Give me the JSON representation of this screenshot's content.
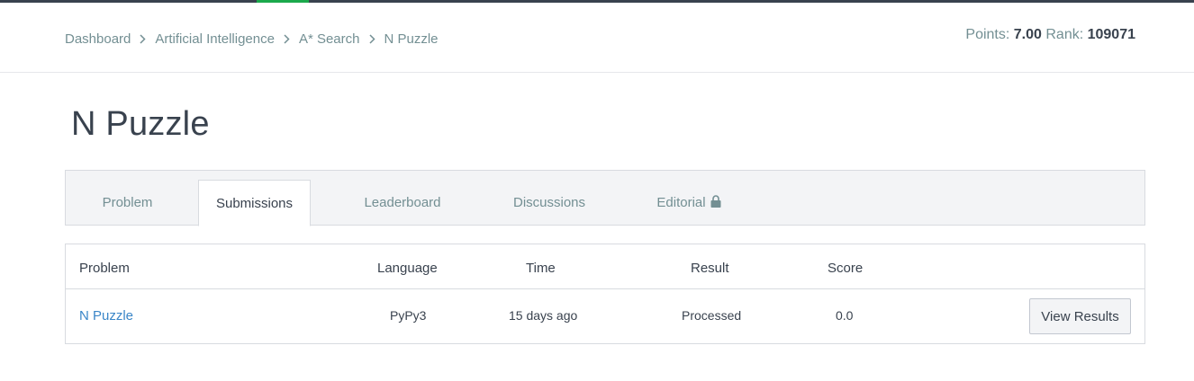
{
  "breadcrumb": {
    "items": [
      "Dashboard",
      "Artificial Intelligence",
      "A* Search",
      "N Puzzle"
    ]
  },
  "stats": {
    "points_label": "Points:",
    "points_value": "7.00",
    "rank_label": "Rank:",
    "rank_value": "109071"
  },
  "page": {
    "title": "N Puzzle"
  },
  "tabs": [
    {
      "label": "Problem"
    },
    {
      "label": "Submissions"
    },
    {
      "label": "Leaderboard"
    },
    {
      "label": "Discussions"
    },
    {
      "label": "Editorial"
    }
  ],
  "table": {
    "headers": [
      "Problem",
      "Language",
      "Time",
      "Result",
      "Score"
    ],
    "rows": [
      {
        "problem": "N Puzzle",
        "language": "PyPy3",
        "time": "15 days ago",
        "result": "Processed",
        "score": "0.0",
        "action": "View Results"
      }
    ]
  },
  "colors": {
    "accent_green": "#1ba94c",
    "link_blue": "#3a86c8",
    "text_dark": "#39424e",
    "text_muted": "#738f93"
  },
  "icons": {
    "breadcrumb_separator": "chevron-right-icon",
    "editorial_lock": "lock-icon"
  }
}
